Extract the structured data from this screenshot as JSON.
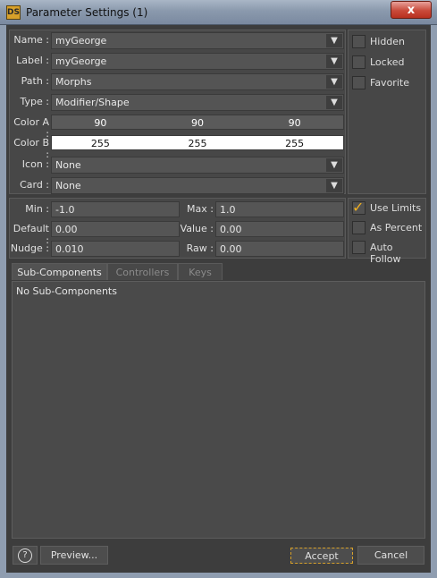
{
  "window": {
    "app_icon_text": "DS",
    "title": "Parameter Settings (1)",
    "close_glyph": "x"
  },
  "fields": {
    "name": {
      "label": "Name :",
      "value": "myGeorge"
    },
    "label": {
      "label": "Label :",
      "value": "myGeorge"
    },
    "path": {
      "label": "Path :",
      "value": "Morphs"
    },
    "type": {
      "label": "Type :",
      "value": "Modifier/Shape"
    },
    "color_a": {
      "label": "Color A :",
      "values": [
        "90",
        "90",
        "90"
      ]
    },
    "color_b": {
      "label": "Color B :",
      "values": [
        "255",
        "255",
        "255"
      ]
    },
    "icon": {
      "label": "Icon :",
      "value": "None"
    },
    "card": {
      "label": "Card :",
      "value": "None"
    }
  },
  "flags": {
    "hidden": {
      "label": "Hidden",
      "checked": false
    },
    "locked": {
      "label": "Locked",
      "checked": false
    },
    "favorite": {
      "label": "Favorite",
      "checked": false
    }
  },
  "limits": {
    "min": {
      "label": "Min :",
      "value": "-1.0"
    },
    "max": {
      "label": "Max :",
      "value": "1.0"
    },
    "default": {
      "label": "Default :",
      "value": "0.00"
    },
    "value": {
      "label": "Value :",
      "value": "0.00"
    },
    "nudge": {
      "label": "Nudge :",
      "value": "0.010"
    },
    "raw": {
      "label": "Raw :",
      "value": "0.00"
    },
    "use_limits": {
      "label": "Use Limits",
      "checked": true
    },
    "as_percent": {
      "label": "As Percent",
      "checked": false
    },
    "auto_follow": {
      "label": "Auto Follow",
      "checked": false
    }
  },
  "tabs": [
    {
      "label": "Sub-Components",
      "active": true
    },
    {
      "label": "Controllers",
      "active": false
    },
    {
      "label": "Keys",
      "active": false
    }
  ],
  "tab_content": {
    "empty_text": "No Sub-Components"
  },
  "footer": {
    "help_glyph": "?",
    "preview_label": "Preview...",
    "accept_label": "Accept",
    "cancel_label": "Cancel"
  },
  "colors": {
    "accent": "#d8a12a",
    "checkmark": "#f0b020",
    "close_red": "#c94a3a"
  }
}
